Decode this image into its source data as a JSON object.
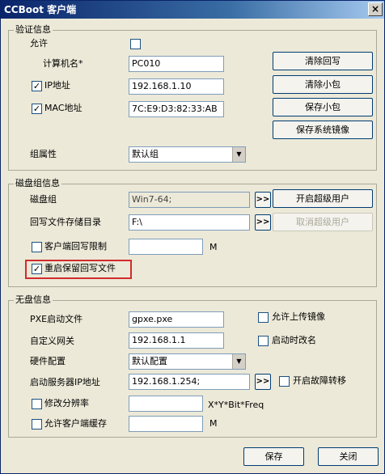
{
  "window": {
    "title": "CCBoot 客户端",
    "close_glyph": "×"
  },
  "auth": {
    "legend": "验证信息",
    "allow_label": "允许",
    "allow_checked": false,
    "computer_name_label": "计算机名*",
    "computer_name_value": "PC010",
    "ip_label": "IP地址",
    "ip_checked": true,
    "ip_value": "192.168.1.10",
    "mac_label": "MAC地址",
    "mac_checked": true,
    "mac_value": "7C:E9:D3:82:33:AB",
    "group_label": "组属性",
    "group_value": "默认组",
    "btn_clear_writeback": "清除回写",
    "btn_clear_small_pkg": "清除小包",
    "btn_save_small_pkg": "保存小包",
    "btn_save_system_image": "保存系统镜像"
  },
  "disk": {
    "legend": "磁盘组信息",
    "disk_group_label": "磁盘组",
    "disk_group_value": "Win7-64;",
    "writeback_dir_label": "回写文件存储目录",
    "writeback_dir_value": "F:\\",
    "limit_label": "客户端回写限制",
    "limit_checked": false,
    "limit_value": "",
    "limit_unit": "M",
    "keep_writeback_label": "重启保留回写文件",
    "keep_writeback_checked": true,
    "btn_enable_super": "开启超级用户",
    "btn_cancel_super": "取消超级用户",
    "more_glyph": ">>"
  },
  "diskless": {
    "legend": "无盘信息",
    "pxe_label": "PXE启动文件",
    "pxe_value": "gpxe.pxe",
    "gateway_label": "自定义网关",
    "gateway_value": "192.168.1.1",
    "hardware_label": "硬件配置",
    "hardware_value": "默认配置",
    "boot_server_label": "启动服务器IP地址",
    "boot_server_value": "192.168.1.254;",
    "resolution_label": "修改分辨率",
    "resolution_checked": false,
    "resolution_value": "",
    "resolution_hint": "X*Y*Bit*Freq",
    "cache_label": "允许客户端缓存",
    "cache_checked": false,
    "cache_value": "",
    "cache_unit": "M",
    "upload_image_label": "允许上传镜像",
    "upload_image_checked": false,
    "rename_label": "启动时改名",
    "rename_checked": false,
    "failover_label": "开启故障转移",
    "failover_checked": false
  },
  "footer": {
    "save": "保存",
    "close": "关闭"
  },
  "check_glyph": "✓",
  "dropdown_glyph": "▼"
}
